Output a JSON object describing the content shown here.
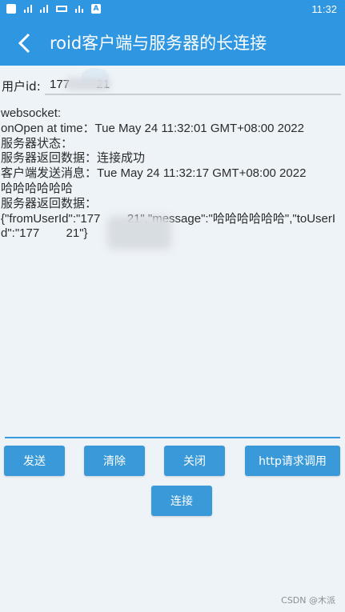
{
  "status_bar": {
    "time": "11:32"
  },
  "app_bar": {
    "title": "roid客户端与服务器的长连接"
  },
  "user": {
    "label": "用户id:",
    "value": "177        21"
  },
  "log": [
    "websocket:",
    "onOpen at time：Tue May 24 11:32:01 GMT+08:00 2022",
    "服务器状态：",
    "服务器返回数据：连接成功",
    "客户端发送消息：Tue May 24 11:32:17 GMT+08:00 2022",
    "哈哈哈哈哈哈",
    "服务器返回数据：",
    "{\"fromUserId\":\"177        21\",\"message\":\"哈哈哈哈哈哈\",\"toUserId\":\"177        21\"}"
  ],
  "buttons": {
    "send": "发送",
    "clear": "清除",
    "close": "关闭",
    "http": "http请求调用",
    "connect": "连接"
  },
  "watermark": "CSDN @木派",
  "colors": {
    "primary": "#2f96e2",
    "button": "#3a9ad9",
    "background": "#eef3f8"
  }
}
